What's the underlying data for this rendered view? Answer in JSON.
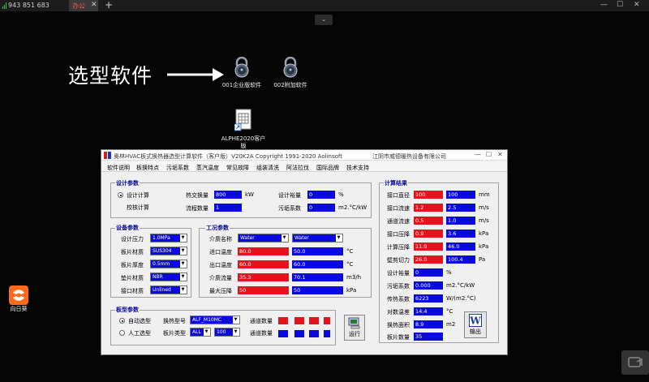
{
  "tabbar": {
    "connection_id": "943 851 683",
    "active_tab": "办公",
    "close_glyph": "✕",
    "add_glyph": "+",
    "minimize": "—",
    "maximize": "☐",
    "close": "✕"
  },
  "dropdown_glyph": "⌄",
  "annotation": "选型软件",
  "desktop": {
    "icons": [
      {
        "label": "001企业版软件"
      },
      {
        "label": "002附加软件"
      },
      {
        "label": "ALPHE2020客户版"
      }
    ],
    "left_app_label": "向日葵"
  },
  "app": {
    "title": "奥林HVAC板式换热器选型计算软件（客户版）V20K2A  Copyright 1991-2020  Aolinsoft",
    "company": "江阴市威德暖热设备有限公司",
    "menu": [
      "软件说明",
      "板换特点",
      "污垢系数",
      "蒸汽温度",
      "常见故障",
      "组装清洗",
      "阿法拉伐",
      "国际品牌",
      "技术支持"
    ],
    "design": {
      "title": "设计参数",
      "radio_design": "设计计算",
      "radio_check": "校核计算",
      "heat_label": "热交换量",
      "heat_value": "800",
      "heat_unit": "kW",
      "flow_label": "流程数量",
      "flow_value": "1",
      "margin_label": "设计裕量",
      "margin_value": "0",
      "margin_unit": "%",
      "fouling_label": "污垢系数",
      "fouling_value": "0",
      "fouling_unit": "m2.°C/kW"
    },
    "equipment": {
      "title": "设备参数",
      "rows": [
        {
          "label": "设计压力",
          "value": "1.0MPa"
        },
        {
          "label": "板片材质",
          "value": "SUS304"
        },
        {
          "label": "板片厚度",
          "value": "0.5mm"
        },
        {
          "label": "垫片材质",
          "value": "NBR"
        },
        {
          "label": "接口材质",
          "value": "Unlined"
        }
      ]
    },
    "working": {
      "title": "工况参数",
      "medium_label": "介质名称",
      "medium_hot": "Water",
      "medium_cold": "Water",
      "rows": [
        {
          "label": "进口温度",
          "hot": "80.0",
          "cold": "50.0",
          "unit": "°C"
        },
        {
          "label": "出口温度",
          "hot": "60.0",
          "cold": "60.0",
          "unit": "°C"
        },
        {
          "label": "介质流量",
          "hot": "35.3",
          "cold": "70.1",
          "unit": "m3/h"
        },
        {
          "label": "最大压降",
          "hot": "50",
          "cold": "50",
          "unit": "kPa"
        }
      ]
    },
    "plate": {
      "title": "板型参数",
      "radio_auto": "自动选型",
      "radio_manual": "人工选型",
      "model_label": "换热型号",
      "model_value": "ALF_M10MC",
      "type_label": "板片类型",
      "type_value": "ALL",
      "type_num": "100",
      "channels_label": "通道数量"
    },
    "run_label": "运行",
    "results": {
      "title": "计算结果",
      "rows": [
        {
          "label": "接口直径",
          "hot": "100",
          "cold": "100",
          "unit": "mm"
        },
        {
          "label": "接口流速",
          "hot": "1.2",
          "cold": "2.5",
          "unit": "m/s"
        },
        {
          "label": "通道流速",
          "hot": "0.5",
          "cold": "1.0",
          "unit": "m/s"
        },
        {
          "label": "接口压降",
          "hot": "0.9",
          "cold": "3.6",
          "unit": "kPa"
        },
        {
          "label": "计算压降",
          "hot": "11.9",
          "cold": "46.0",
          "unit": "kPa"
        },
        {
          "label": "壁剪切力",
          "hot": "26.0",
          "cold": "100.4",
          "unit": "Pa"
        }
      ],
      "single_rows": [
        {
          "label": "设计裕量",
          "value": "0",
          "unit": "%"
        },
        {
          "label": "污垢系数",
          "value": "0.000",
          "unit": "m2.°C/kW"
        },
        {
          "label": "传热系数",
          "value": "6223",
          "unit": "W/(m2.°C)"
        },
        {
          "label": "对数温差",
          "value": "14.4",
          "unit": "°C"
        },
        {
          "label": "换热面积",
          "value": "8.9",
          "unit": "m2"
        },
        {
          "label": "板片数量",
          "value": "35",
          "unit": ""
        }
      ],
      "output_label": "输出"
    }
  }
}
